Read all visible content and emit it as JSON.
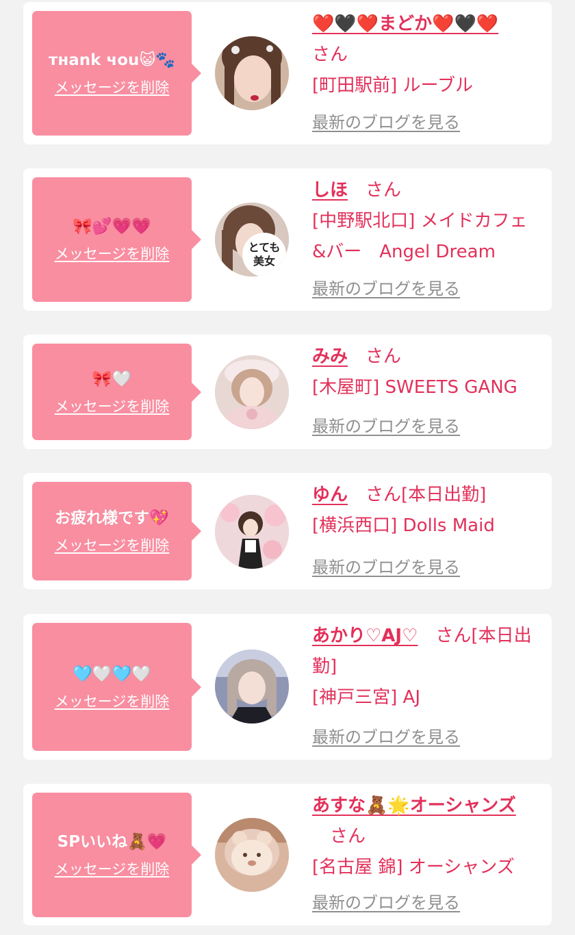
{
  "delete_label": "メッセージを削除",
  "blog_label": "最新のブログを見る",
  "cards": [
    {
      "message": "тнank чou😺🐾",
      "name": "❤️🖤❤️まどか❤️🖤❤️",
      "honorific": "さん",
      "shop": "[町田駅前] ルーブル",
      "avatar_overlay": ""
    },
    {
      "message": "🎀💕💗💗",
      "name": "しほ",
      "honorific": "さん",
      "shop": "[中野駅北口] メイドカフェ&バー　Angel Dream",
      "avatar_overlay": "とても美女"
    },
    {
      "message": "🎀🤍",
      "name": "みみ",
      "honorific": "さん",
      "shop": "[木屋町] SWEETS GANG",
      "avatar_overlay": ""
    },
    {
      "message": "お疲れ様です💖",
      "name": "ゆん",
      "honorific": "さん[本日出勤]",
      "shop": "[横浜西口] Dolls Maid",
      "avatar_overlay": ""
    },
    {
      "message": "🩵🤍🩵🤍",
      "name": "あかり♡AJ♡",
      "honorific": "さん[本日出勤]",
      "shop": "[神戸三宮] AJ",
      "avatar_overlay": ""
    },
    {
      "message": "SPいいね🧸💗",
      "name": "あすな🧸🌟オーシャンズ",
      "honorific": "さん",
      "shop": "[名古屋 錦] オーシャンズ",
      "avatar_overlay": ""
    }
  ],
  "colors": {
    "accent": "#e2305a",
    "bubble": "#f98ea1",
    "link_gray": "#8f8f8f",
    "background": "#f2f2f2"
  }
}
